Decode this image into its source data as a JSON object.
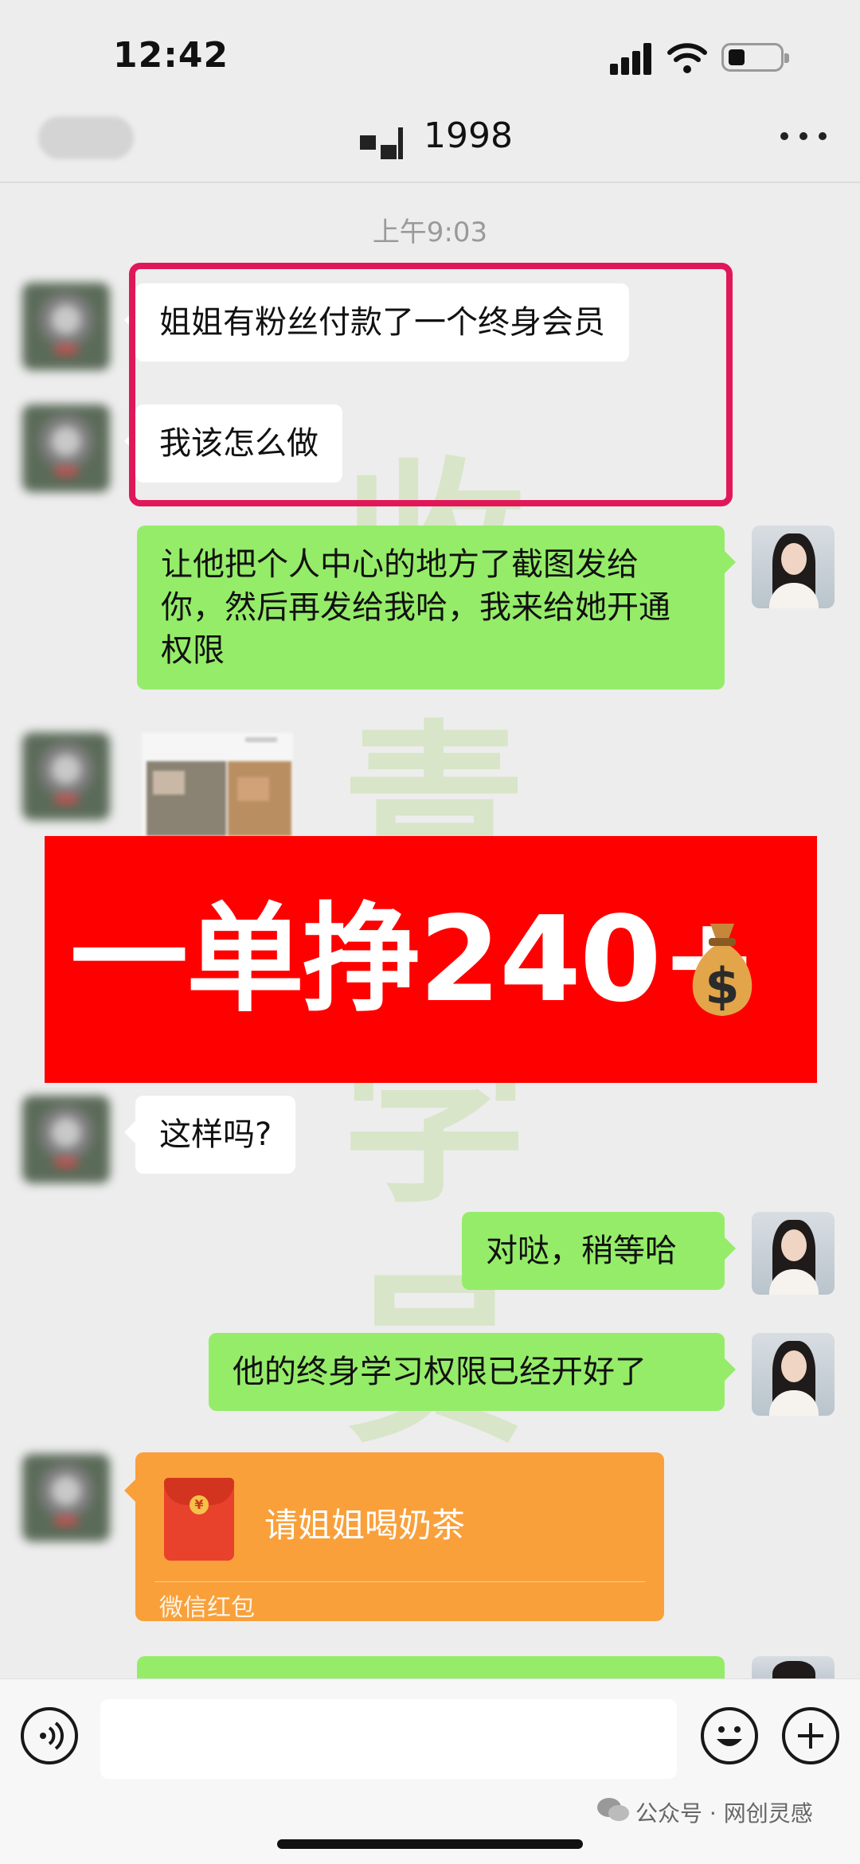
{
  "status_bar": {
    "time": "12:42"
  },
  "header": {
    "title": "1998"
  },
  "chat": {
    "timestamp": "上午9:03",
    "messages": [
      {
        "side": "left",
        "text": "姐姐有粉丝付款了一个终身会员"
      },
      {
        "side": "left",
        "text": "我该怎么做"
      },
      {
        "side": "right",
        "text": "让他把个人中心的地方了截图发给你，然后再发给我哈，我来给她开通权限"
      },
      {
        "side": "left",
        "text": "这样吗?"
      },
      {
        "side": "right",
        "text": "对哒，稍等哈"
      },
      {
        "side": "right",
        "text": "他的终身学习权限已经开好了"
      }
    ],
    "red_packet": {
      "title": "请姐姐喝奶茶",
      "label": "微信红包"
    }
  },
  "banner": {
    "text": "一单挣240+"
  },
  "watermark": {
    "chars": [
      "收",
      "青",
      "学",
      "员"
    ]
  },
  "footer": {
    "account_watermark": "公众号 · 网创灵感"
  },
  "colors": {
    "my_bubble": "#95ec69",
    "banner_bg": "#ff0000",
    "highlight_border": "#e0185a",
    "red_packet": "#f9a03b"
  }
}
